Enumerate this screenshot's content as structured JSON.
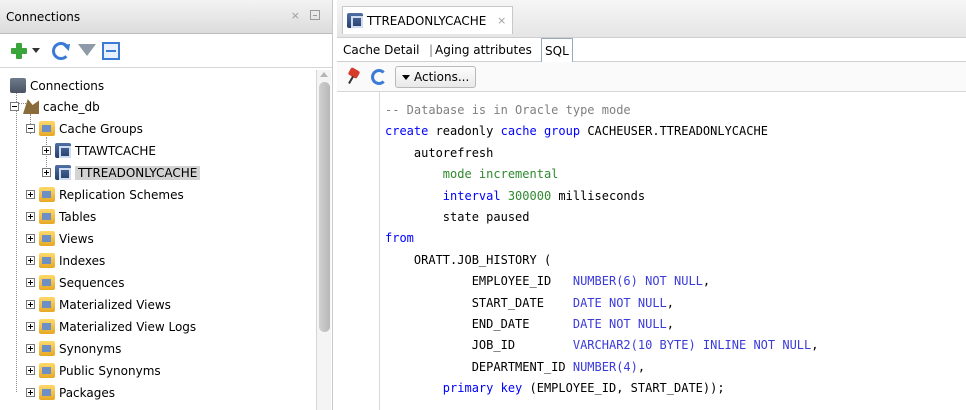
{
  "left_panel": {
    "title": "Connections",
    "close_symbol": "×",
    "tree": {
      "root": "Connections",
      "database": "cache_db",
      "cache_groups": "Cache Groups",
      "cache_items": [
        "TTAWTCACHE",
        "TTREADONLYCACHE"
      ],
      "other_nodes": [
        "Replication Schemes",
        "Tables",
        "Views",
        "Indexes",
        "Sequences",
        "Materialized Views",
        "Materialized View Logs",
        "Synonyms",
        "Public Synonyms",
        "Packages"
      ]
    },
    "icons": [
      "plus-icon",
      "dropdown-arrow-icon",
      "refresh-icon",
      "filter-icon",
      "schema-browser-icon"
    ]
  },
  "right_panel": {
    "tab_title": "TTREADONLYCACHE",
    "tab_close": "×",
    "subtabs": [
      "Cache Detail",
      "Aging attributes",
      "SQL"
    ],
    "active_subtab": "SQL",
    "actions_label": "Actions...",
    "code_lines": [
      [
        {
          "t": "cm",
          "v": "-- Database is in Oracle type mode"
        }
      ],
      [
        {
          "t": "kw",
          "v": "create"
        },
        {
          "t": "tx",
          "v": " readonly "
        },
        {
          "t": "kw",
          "v": "cache group"
        },
        {
          "t": "tx",
          "v": " CACHEUSER.TTREADONLYCACHE"
        }
      ],
      [
        {
          "t": "tx",
          "v": "    autorefresh"
        }
      ],
      [
        {
          "t": "tx",
          "v": "        "
        },
        {
          "t": "nm",
          "v": "mode incremental"
        }
      ],
      [
        {
          "t": "tx",
          "v": "        "
        },
        {
          "t": "kw",
          "v": "interval"
        },
        {
          "t": "tx",
          "v": " "
        },
        {
          "t": "nm",
          "v": "300000"
        },
        {
          "t": "tx",
          "v": " milliseconds"
        }
      ],
      [
        {
          "t": "tx",
          "v": "        state paused"
        }
      ],
      [
        {
          "t": "kw",
          "v": "from"
        }
      ],
      [
        {
          "t": "tx",
          "v": "    ORATT.JOB_HISTORY ("
        }
      ],
      [
        {
          "t": "tx",
          "v": "            EMPLOYEE_ID   "
        },
        {
          "t": "ty",
          "v": "NUMBER(6) NOT NULL"
        },
        {
          "t": "tx",
          "v": ","
        }
      ],
      [
        {
          "t": "tx",
          "v": "            START_DATE    "
        },
        {
          "t": "ty",
          "v": "DATE NOT NULL"
        },
        {
          "t": "tx",
          "v": ","
        }
      ],
      [
        {
          "t": "tx",
          "v": "            END_DATE      "
        },
        {
          "t": "ty",
          "v": "DATE NOT NULL"
        },
        {
          "t": "tx",
          "v": ","
        }
      ],
      [
        {
          "t": "tx",
          "v": "            JOB_ID        "
        },
        {
          "t": "ty",
          "v": "VARCHAR2(10 BYTE) INLINE NOT NULL"
        },
        {
          "t": "tx",
          "v": ","
        }
      ],
      [
        {
          "t": "tx",
          "v": "            DEPARTMENT_ID "
        },
        {
          "t": "ty",
          "v": "NUMBER(4)"
        },
        {
          "t": "tx",
          "v": ","
        }
      ],
      [
        {
          "t": "tx",
          "v": "        "
        },
        {
          "t": "kw",
          "v": "primary key"
        },
        {
          "t": "tx",
          "v": " (EMPLOYEE_ID, START_DATE));"
        }
      ]
    ]
  }
}
